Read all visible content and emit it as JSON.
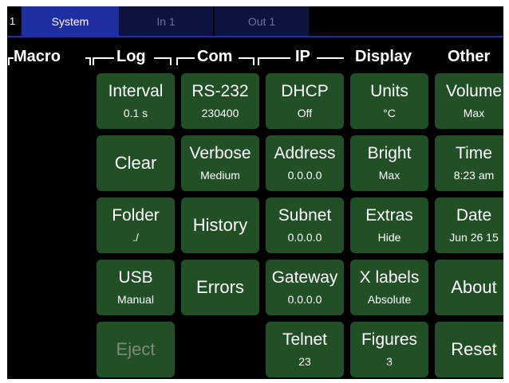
{
  "tabs": {
    "number": "1",
    "items": [
      {
        "label": "System",
        "active": true
      },
      {
        "label": "In 1",
        "active": false
      },
      {
        "label": "Out 1",
        "active": false
      }
    ]
  },
  "headers": {
    "macro": "Macro",
    "log": "Log",
    "com": "Com",
    "ip": "IP",
    "display": "Display",
    "other": "Other"
  },
  "buttons": {
    "interval": {
      "label": "Interval",
      "value": "0.1 s"
    },
    "clear": {
      "label": "Clear"
    },
    "folder": {
      "label": "Folder",
      "value": "./"
    },
    "usb": {
      "label": "USB",
      "value": "Manual"
    },
    "eject": {
      "label": "Eject",
      "disabled": true
    },
    "rs232": {
      "label": "RS-232",
      "value": "230400"
    },
    "verbose": {
      "label": "Verbose",
      "value": "Medium"
    },
    "history": {
      "label": "History"
    },
    "errors": {
      "label": "Errors"
    },
    "dhcp": {
      "label": "DHCP",
      "value": "Off"
    },
    "address": {
      "label": "Address",
      "value": "0.0.0.0"
    },
    "subnet": {
      "label": "Subnet",
      "value": "0.0.0.0"
    },
    "gateway": {
      "label": "Gateway",
      "value": "0.0.0.0"
    },
    "telnet": {
      "label": "Telnet",
      "value": "23"
    },
    "units": {
      "label": "Units",
      "value": "°C"
    },
    "bright": {
      "label": "Bright",
      "value": "Max"
    },
    "extras": {
      "label": "Extras",
      "value": "Hide"
    },
    "xlabels": {
      "label": "X labels",
      "value": "Absolute"
    },
    "figures": {
      "label": "Figures",
      "value": "3"
    },
    "volume": {
      "label": "Volume",
      "value": "Max"
    },
    "time": {
      "label": "Time",
      "value": "8:23 am"
    },
    "date": {
      "label": "Date",
      "value": "Jun 26 15"
    },
    "about": {
      "label": "About"
    },
    "reset": {
      "label": "Reset"
    }
  },
  "colors": {
    "button_bg": "#214f26",
    "tab_active": "#1f2ea0",
    "tab_inactive": "#0d1240",
    "screen_bg": "#000000"
  }
}
